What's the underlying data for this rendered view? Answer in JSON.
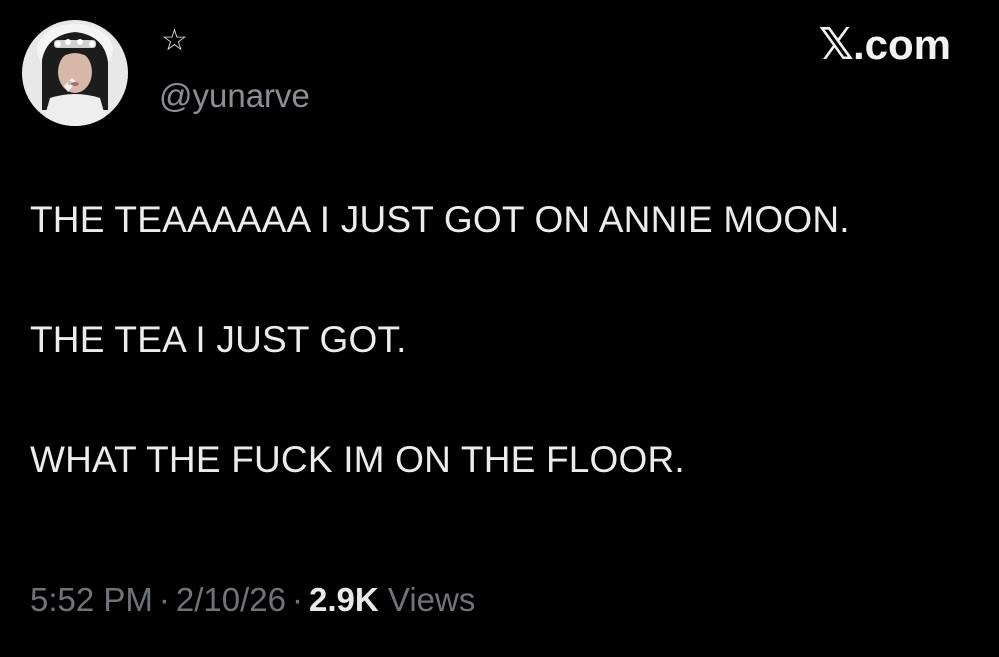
{
  "author": {
    "display_name": "☆",
    "handle": "@yunarve",
    "avatar_icon": "profile-photo"
  },
  "brand": {
    "symbol": "𝕏",
    "domain": ".com"
  },
  "tweet": {
    "lines": [
      "THE TEAAAAAA I JUST GOT ON ANNIE MOON.",
      "THE TEA I JUST GOT.",
      "WHAT THE FUCK IM ON THE FLOOR."
    ]
  },
  "meta": {
    "time": "5:52 PM",
    "separator": "·",
    "date": "2/10/26",
    "views_count": "2.9K",
    "views_label": "Views"
  },
  "colors": {
    "background": "#000000",
    "text_primary": "#e7e9ea",
    "text_secondary": "#6f7479"
  }
}
